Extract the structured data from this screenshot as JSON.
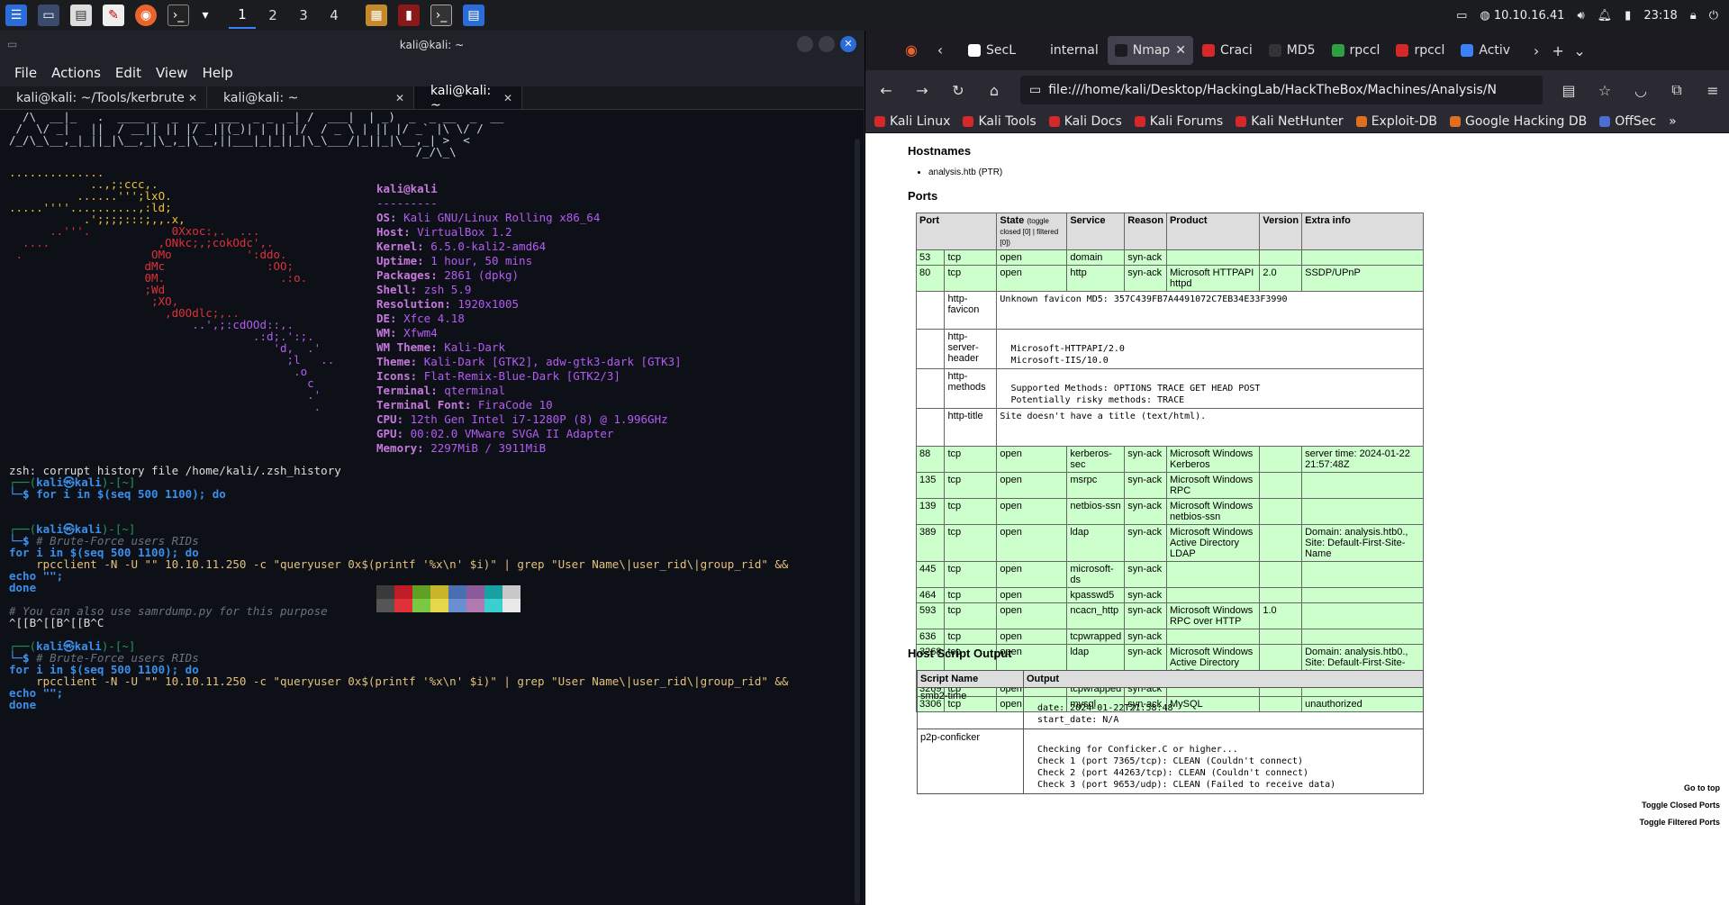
{
  "panel": {
    "workspaces": [
      "1",
      "2",
      "3",
      "4"
    ],
    "active_workspace": "1",
    "tray_ip": "10.10.16.41",
    "clock": "23:18"
  },
  "terminal": {
    "title": "kali@kali: ~",
    "menu": [
      "File",
      "Actions",
      "Edit",
      "View",
      "Help"
    ],
    "tabs": [
      {
        "label": "kali@kali: ~/Tools/kerbrute"
      },
      {
        "label": "kali@kali: ~"
      },
      {
        "label": "kali@kali: ~"
      }
    ],
    "ascii_art": [
      "  /\\  __|_   .  ____ _  _  __  ___  _ _  _| /  ___|  | _)  _  _ __  _  __ ",
      " /  \\/ _|   ||  / __|| || |/ _||(_)| | || |/  / _ \\ | || |/ _` |\\ \\/ /  ",
      "/_/\\_\\__,_|_||_|\\__,_|\\_,_|\\__,||___|_|_||_|\\_\\___/|_||_|\\__,_| >  <   ",
      "                                                            /_/\\_\\  "
    ],
    "logo_lines": [
      "..............",
      "            ..,;:ccc,.",
      "          ......''';lxO.",
      ".....''''..........,:ld;",
      "           .';;;;:::;,,.x,",
      "      ..'''.            0Xxoc:,.  ...",
      "  ....                ,ONkc;,;cokOdc',.",
      " .                   OMo           ':ddo.",
      "                    dMc               :OO;",
      "                    0M.                 .:o.",
      "                    ;Wd",
      "                     ;XO,",
      "                       ,d0Odlc;,..",
      "                           ..',;:cdOOd::,.",
      "                                    .:d;.':;.",
      "                                       'd,  .'",
      "                                         ;l   ..",
      "                                          .o",
      "                                            c",
      "                                            .'",
      "                                             ."
    ],
    "neofetch": {
      "user_host": "kali@kali",
      "separator": "---------",
      "rows": [
        {
          "k": "OS",
          "v": "Kali GNU/Linux Rolling x86_64"
        },
        {
          "k": "Host",
          "v": "VirtualBox 1.2"
        },
        {
          "k": "Kernel",
          "v": "6.5.0-kali2-amd64"
        },
        {
          "k": "Uptime",
          "v": "1 hour, 50 mins"
        },
        {
          "k": "Packages",
          "v": "2861 (dpkg)"
        },
        {
          "k": "Shell",
          "v": "zsh 5.9"
        },
        {
          "k": "Resolution",
          "v": "1920x1005"
        },
        {
          "k": "DE",
          "v": "Xfce 4.18"
        },
        {
          "k": "WM",
          "v": "Xfwm4"
        },
        {
          "k": "WM Theme",
          "v": "Kali-Dark"
        },
        {
          "k": "Theme",
          "v": "Kali-Dark [GTK2], adw-gtk3-dark [GTK3]"
        },
        {
          "k": "Icons",
          "v": "Flat-Remix-Blue-Dark [GTK2/3]"
        },
        {
          "k": "Terminal",
          "v": "qterminal"
        },
        {
          "k": "Terminal Font",
          "v": "FiraCode 10"
        },
        {
          "k": "CPU",
          "v": "12th Gen Intel i7-1280P (8) @ 1.996GHz"
        },
        {
          "k": "GPU",
          "v": "00:02.0 VMware SVGA II Adapter"
        },
        {
          "k": "Memory",
          "v": "2297MiB / 3911MiB"
        }
      ],
      "palette": [
        "#3a3a3a",
        "#c01c28",
        "#5fa023",
        "#c8b428",
        "#4a6fb0",
        "#8a5a9a",
        "#19a0a0",
        "#c8c8c8",
        "#555555",
        "#e0303a",
        "#7ac943",
        "#e5d64a",
        "#6a8fd0",
        "#b07ab0",
        "#3ad0d0",
        "#e8e8e8"
      ]
    },
    "lines": {
      "corrupt": "zsh: corrupt history file /home/kali/.zsh_history",
      "prompt_top": "┌──(",
      "prompt_user": "kali㉿kali",
      "prompt_dir": ")-[~]",
      "prompt_bottom": "└─$",
      "cmd1": " for i in $(seq 500 1100); do",
      "comment_brute": " # Brute-Force users RIDs",
      "for_line": "for i in $(seq 500 1100); do",
      "rpc_line": "    rpcclient -N -U \"\" 10.10.11.250 -c \"queryuser 0x$(printf '%x\\n' $i)\" | grep \"User Name\\|user_rid\\|group_rid\" &&",
      "echo_line": "echo \"\";",
      "done_line": "done",
      "comment_samr": "# You can also use samrdump.py for this purpose",
      "escape_line": "^[[B^[[B^[[B^C"
    }
  },
  "firefox": {
    "tabs": [
      {
        "label": "SecL",
        "color": "#ffffff"
      },
      {
        "label": "internal",
        "color": "#1c1b22"
      },
      {
        "label": "Nmap",
        "color": "#1c1b22"
      },
      {
        "label": "Craci",
        "color": "#d62828"
      },
      {
        "label": "MD5",
        "color": "#333333"
      },
      {
        "label": "rpccl",
        "color": "#2ea043"
      },
      {
        "label": "rpccl",
        "color": "#d62828"
      },
      {
        "label": "Activ",
        "color": "#3b82f6"
      }
    ],
    "active_tab": "Nmap",
    "url": "file:///home/kali/Desktop/HackingLab/HackTheBox/Machines/Analysis/N",
    "bookmarks": [
      {
        "label": "Kali Linux",
        "color": "#d62828"
      },
      {
        "label": "Kali Tools",
        "color": "#d62828"
      },
      {
        "label": "Kali Docs",
        "color": "#d62828"
      },
      {
        "label": "Kali Forums",
        "color": "#d62828"
      },
      {
        "label": "Kali NetHunter",
        "color": "#d62828"
      },
      {
        "label": "Exploit-DB",
        "color": "#e07020"
      },
      {
        "label": "Google Hacking DB",
        "color": "#e07020"
      },
      {
        "label": "OffSec",
        "color": "#4a6fd0"
      }
    ]
  },
  "report": {
    "hostnames_heading": "Hostnames",
    "hostname": "analysis.htb (PTR)",
    "ports_heading": "Ports",
    "headers": {
      "port": "Port",
      "state": "State",
      "toggle": "(toggle closed [0] | filtered [0])",
      "service": "Service",
      "reason": "Reason",
      "product": "Product",
      "version": "Version",
      "extra": "Extra info"
    },
    "ports": [
      {
        "port": "53",
        "proto": "tcp",
        "state": "open",
        "service": "domain",
        "reason": "syn-ack",
        "product": "",
        "version": "",
        "extra": ""
      },
      {
        "port": "80",
        "proto": "tcp",
        "state": "open",
        "service": "http",
        "reason": "syn-ack",
        "product": "Microsoft HTTPAPI httpd",
        "version": "2.0",
        "extra": "SSDP/UPnP"
      }
    ],
    "scripts80": [
      {
        "name": "http-favicon",
        "out": "Unknown favicon MD5: 357C439FB7A4491072C7EB34E33F3990"
      },
      {
        "name": "http-server-header",
        "out": "\n  Microsoft-HTTPAPI/2.0\n  Microsoft-IIS/10.0\n"
      },
      {
        "name": "http-methods",
        "out": "\n  Supported Methods: OPTIONS TRACE GET HEAD POST\n  Potentially risky methods: TRACE\n"
      },
      {
        "name": "http-title",
        "out": "Site doesn't have a title (text/html)."
      }
    ],
    "ports2": [
      {
        "port": "88",
        "proto": "tcp",
        "state": "open",
        "service": "kerberos-sec",
        "reason": "syn-ack",
        "product": "Microsoft Windows Kerberos",
        "version": "",
        "extra": "server time: 2024-01-22 21:57:48Z"
      },
      {
        "port": "135",
        "proto": "tcp",
        "state": "open",
        "service": "msrpc",
        "reason": "syn-ack",
        "product": "Microsoft Windows RPC",
        "version": "",
        "extra": ""
      },
      {
        "port": "139",
        "proto": "tcp",
        "state": "open",
        "service": "netbios-ssn",
        "reason": "syn-ack",
        "product": "Microsoft Windows netbios-ssn",
        "version": "",
        "extra": ""
      },
      {
        "port": "389",
        "proto": "tcp",
        "state": "open",
        "service": "ldap",
        "reason": "syn-ack",
        "product": "Microsoft Windows Active Directory LDAP",
        "version": "",
        "extra": "Domain: analysis.htb0., Site: Default-First-Site-Name"
      },
      {
        "port": "445",
        "proto": "tcp",
        "state": "open",
        "service": "microsoft-ds",
        "reason": "syn-ack",
        "product": "",
        "version": "",
        "extra": ""
      },
      {
        "port": "464",
        "proto": "tcp",
        "state": "open",
        "service": "kpasswd5",
        "reason": "syn-ack",
        "product": "",
        "version": "",
        "extra": ""
      },
      {
        "port": "593",
        "proto": "tcp",
        "state": "open",
        "service": "ncacn_http",
        "reason": "syn-ack",
        "product": "Microsoft Windows RPC over HTTP",
        "version": "1.0",
        "extra": ""
      },
      {
        "port": "636",
        "proto": "tcp",
        "state": "open",
        "service": "tcpwrapped",
        "reason": "syn-ack",
        "product": "",
        "version": "",
        "extra": ""
      },
      {
        "port": "3268",
        "proto": "tcp",
        "state": "open",
        "service": "ldap",
        "reason": "syn-ack",
        "product": "Microsoft Windows Active Directory LDAP",
        "version": "",
        "extra": "Domain: analysis.htb0., Site: Default-First-Site-Name"
      },
      {
        "port": "3269",
        "proto": "tcp",
        "state": "open",
        "service": "tcpwrapped",
        "reason": "syn-ack",
        "product": "",
        "version": "",
        "extra": ""
      },
      {
        "port": "3306",
        "proto": "tcp",
        "state": "open",
        "service": "mysql",
        "reason": "syn-ack",
        "product": "MySQL",
        "version": "",
        "extra": "unauthorized"
      }
    ],
    "host_script_heading": "Host Script Output",
    "host_headers": {
      "name": "Script Name",
      "output": "Output"
    },
    "host_scripts": [
      {
        "name": "smb2-time",
        "out": "\n  date: 2024-01-22T21:58:48\n  start_date: N/A\n"
      },
      {
        "name": "p2p-conficker",
        "out": "\n  Checking for Conficker.C or higher...\n  Check 1 (port 7365/tcp): CLEAN (Couldn't connect)\n  Check 2 (port 44263/tcp): CLEAN (Couldn't connect)\n  Check 3 (port 9653/udp): CLEAN (Failed to receive data)"
      }
    ],
    "side_links": [
      "Go to top",
      "Toggle Closed Ports",
      "Toggle Filtered Ports"
    ]
  }
}
